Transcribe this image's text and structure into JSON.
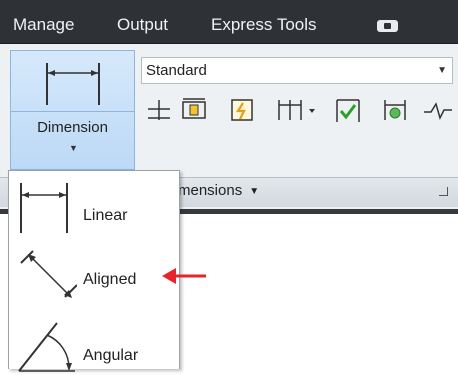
{
  "tabs": {
    "manage": "Manage",
    "output": "Output",
    "express_tools": "Express Tools"
  },
  "ribbon": {
    "dimension_button_label": "Dimension",
    "style_selector_value": "Standard",
    "panel_title": "Dimensions",
    "panel_title_visible": "mensions"
  },
  "dimension_menu": {
    "items": [
      {
        "label": "Linear",
        "icon": "linear-dimension-icon"
      },
      {
        "label": "Aligned",
        "icon": "aligned-dimension-icon"
      },
      {
        "label": "Angular",
        "icon": "angular-dimension-icon"
      }
    ]
  },
  "colors": {
    "tabbar": "#2e3236",
    "ribbon": "#eef1f4",
    "active_button": "#c7e0f8",
    "annotation_arrow": "#e8232a"
  }
}
